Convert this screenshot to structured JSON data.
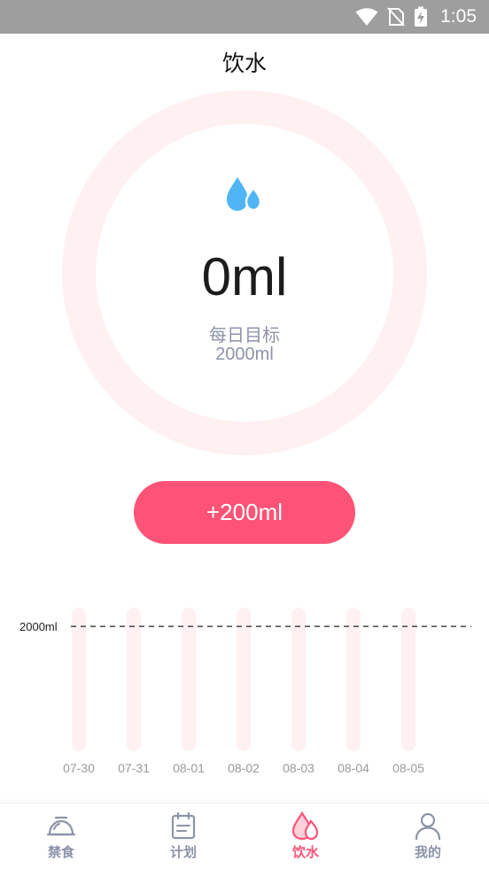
{
  "status_bar": {
    "time": "1:05"
  },
  "header": {
    "title": "饮水"
  },
  "progress": {
    "current": "0ml",
    "goal_label": "每日目标",
    "goal_value": "2000ml",
    "fraction": 0
  },
  "add_button": {
    "label": "+200ml"
  },
  "chart_data": {
    "type": "bar",
    "categories": [
      "07-30",
      "07-31",
      "08-01",
      "08-02",
      "08-03",
      "08-04",
      "08-05"
    ],
    "values": [
      0,
      0,
      0,
      0,
      0,
      0,
      0
    ],
    "goal": 2000,
    "goal_label": "2000ml",
    "ylim": [
      0,
      2300
    ],
    "title": "",
    "xlabel": "",
    "ylabel": "",
    "grid": false,
    "colors": {
      "track": "#fff0f2",
      "fill": "#fe5376",
      "goal_line": "#222222",
      "tick": "#9a9a9a"
    }
  },
  "tabs": [
    {
      "label": "禁食",
      "icon": "bowl-icon",
      "active": false
    },
    {
      "label": "计划",
      "icon": "calendar-icon",
      "active": false
    },
    {
      "label": "饮水",
      "icon": "water-drop-icon",
      "active": true
    },
    {
      "label": "我的",
      "icon": "person-icon",
      "active": false
    }
  ],
  "colors": {
    "accent": "#fe5376",
    "ring": "#fff0f2",
    "drop": "#4fb5f5",
    "muted": "#8d93a8",
    "status_bar": "#9e9e9e"
  }
}
